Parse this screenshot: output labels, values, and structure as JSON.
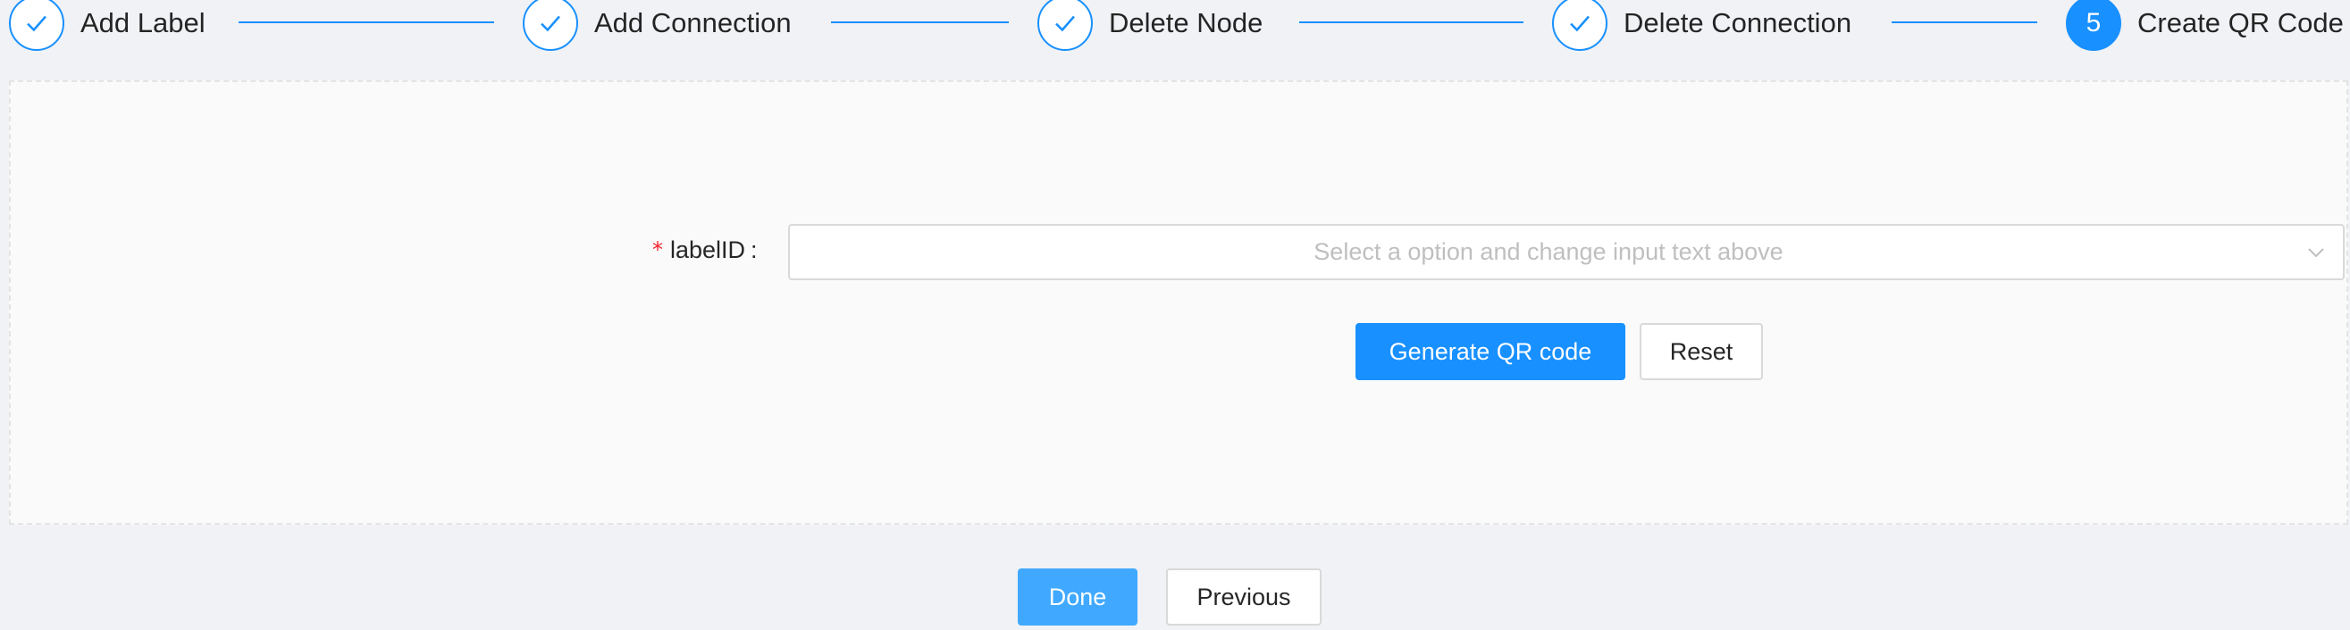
{
  "steps": [
    {
      "title": "Add Label",
      "status": "finished",
      "icon": "check-icon"
    },
    {
      "title": "Add Connection",
      "status": "finished",
      "icon": "check-icon"
    },
    {
      "title": "Delete Node",
      "status": "finished",
      "icon": "check-icon"
    },
    {
      "title": "Delete Connection",
      "status": "finished",
      "icon": "check-icon"
    },
    {
      "title": "Create QR Code",
      "status": "active",
      "number": "5"
    }
  ],
  "form": {
    "required_mark": "*",
    "label": "labelID",
    "colon": ":",
    "select_placeholder": "Select a option and change input text above",
    "select_icon": "chevron-down-icon",
    "generate_button": "Generate QR code",
    "reset_button": "Reset"
  },
  "footer": {
    "done_button": "Done",
    "previous_button": "Previous"
  },
  "colors": {
    "primary": "#1890ff",
    "primary_light": "#40a9ff",
    "required": "#f5222d",
    "page_bg": "#f0f2f5",
    "panel_bg": "#fafafa"
  }
}
